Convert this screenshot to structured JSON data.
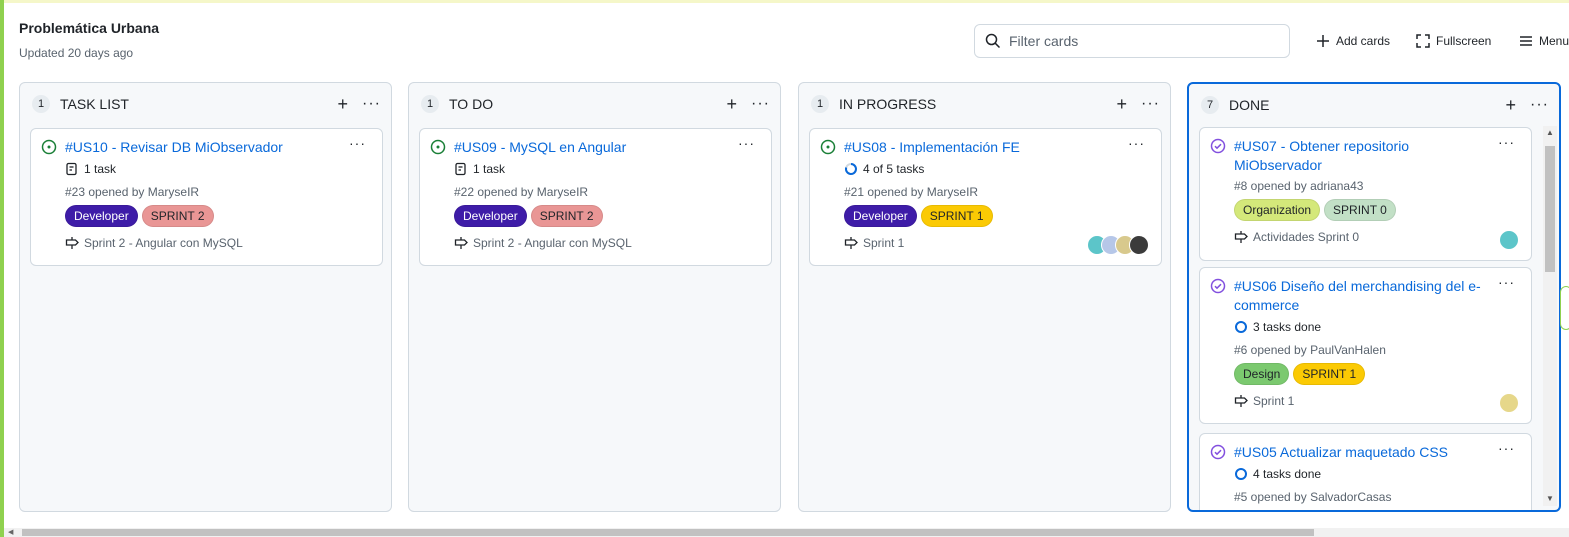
{
  "header": {
    "title": "Problemática Urbana",
    "updated": "Updated 20 days ago"
  },
  "toolbar": {
    "filter_placeholder": "Filter cards",
    "add_cards": "Add cards",
    "fullscreen": "Fullscreen",
    "menu": "Menu"
  },
  "colors": {
    "accent": "#0969da",
    "open_issue": "#1a7f37",
    "closed_issue": "#8250df"
  },
  "columns": [
    {
      "count": "1",
      "title": "TASK LIST",
      "cards": [
        {
          "title": "#US10 - Revisar DB MiObservador",
          "progress": "1 task",
          "opened": "#23 opened by MaryseIR",
          "labels": [
            {
              "text": "Developer",
              "bg": "#3e1ca8",
              "fg": "#ffffff"
            },
            {
              "text": "SPRINT 2",
              "bg": "#e99695",
              "fg": "#1f2328"
            }
          ],
          "milestone": "Sprint 2 - Angular con MySQL"
        }
      ]
    },
    {
      "count": "1",
      "title": "TO DO",
      "cards": [
        {
          "title": "#US09 - MySQL en Angular",
          "progress": "1 task",
          "opened": "#22 opened by MaryseIR",
          "labels": [
            {
              "text": "Developer",
              "bg": "#3e1ca8",
              "fg": "#ffffff"
            },
            {
              "text": "SPRINT 2",
              "bg": "#e99695",
              "fg": "#1f2328"
            }
          ],
          "milestone": "Sprint 2 - Angular con MySQL"
        }
      ]
    },
    {
      "count": "1",
      "title": "IN PROGRESS",
      "cards": [
        {
          "title": "#US08 - Implementación FE",
          "progress": "4 of 5 tasks",
          "opened": "#21 opened by MaryseIR",
          "labels": [
            {
              "text": "Developer",
              "bg": "#3e1ca8",
              "fg": "#ffffff"
            },
            {
              "text": "SPRINT 1",
              "bg": "#fbca04",
              "fg": "#1f2328"
            }
          ],
          "milestone": "Sprint 1"
        }
      ]
    },
    {
      "count": "7",
      "title": "DONE",
      "cards": [
        {
          "title": "#US07 - Obtener repositorio MiObservador",
          "opened": "#8 opened by adriana43",
          "labels": [
            {
              "text": "Organization",
              "bg": "#d4e87a",
              "fg": "#1f2328"
            },
            {
              "text": "SPRINT 0",
              "bg": "#c2e0c6",
              "fg": "#1f2328"
            }
          ],
          "milestone": "Actividades Sprint 0"
        },
        {
          "title": "#US06 Diseño del merchandising del e-commerce",
          "progress": "3 tasks done",
          "opened": "#6 opened by PaulVanHalen",
          "labels": [
            {
              "text": "Design",
              "bg": "#7bc96f",
              "fg": "#1f2328"
            },
            {
              "text": "SPRINT 1",
              "bg": "#fbca04",
              "fg": "#1f2328"
            }
          ],
          "milestone": "Sprint 1"
        },
        {
          "title": "#US05 Actualizar maquetado CSS",
          "progress": "4 tasks done",
          "opened": "#5 opened by SalvadorCasas"
        }
      ]
    }
  ]
}
